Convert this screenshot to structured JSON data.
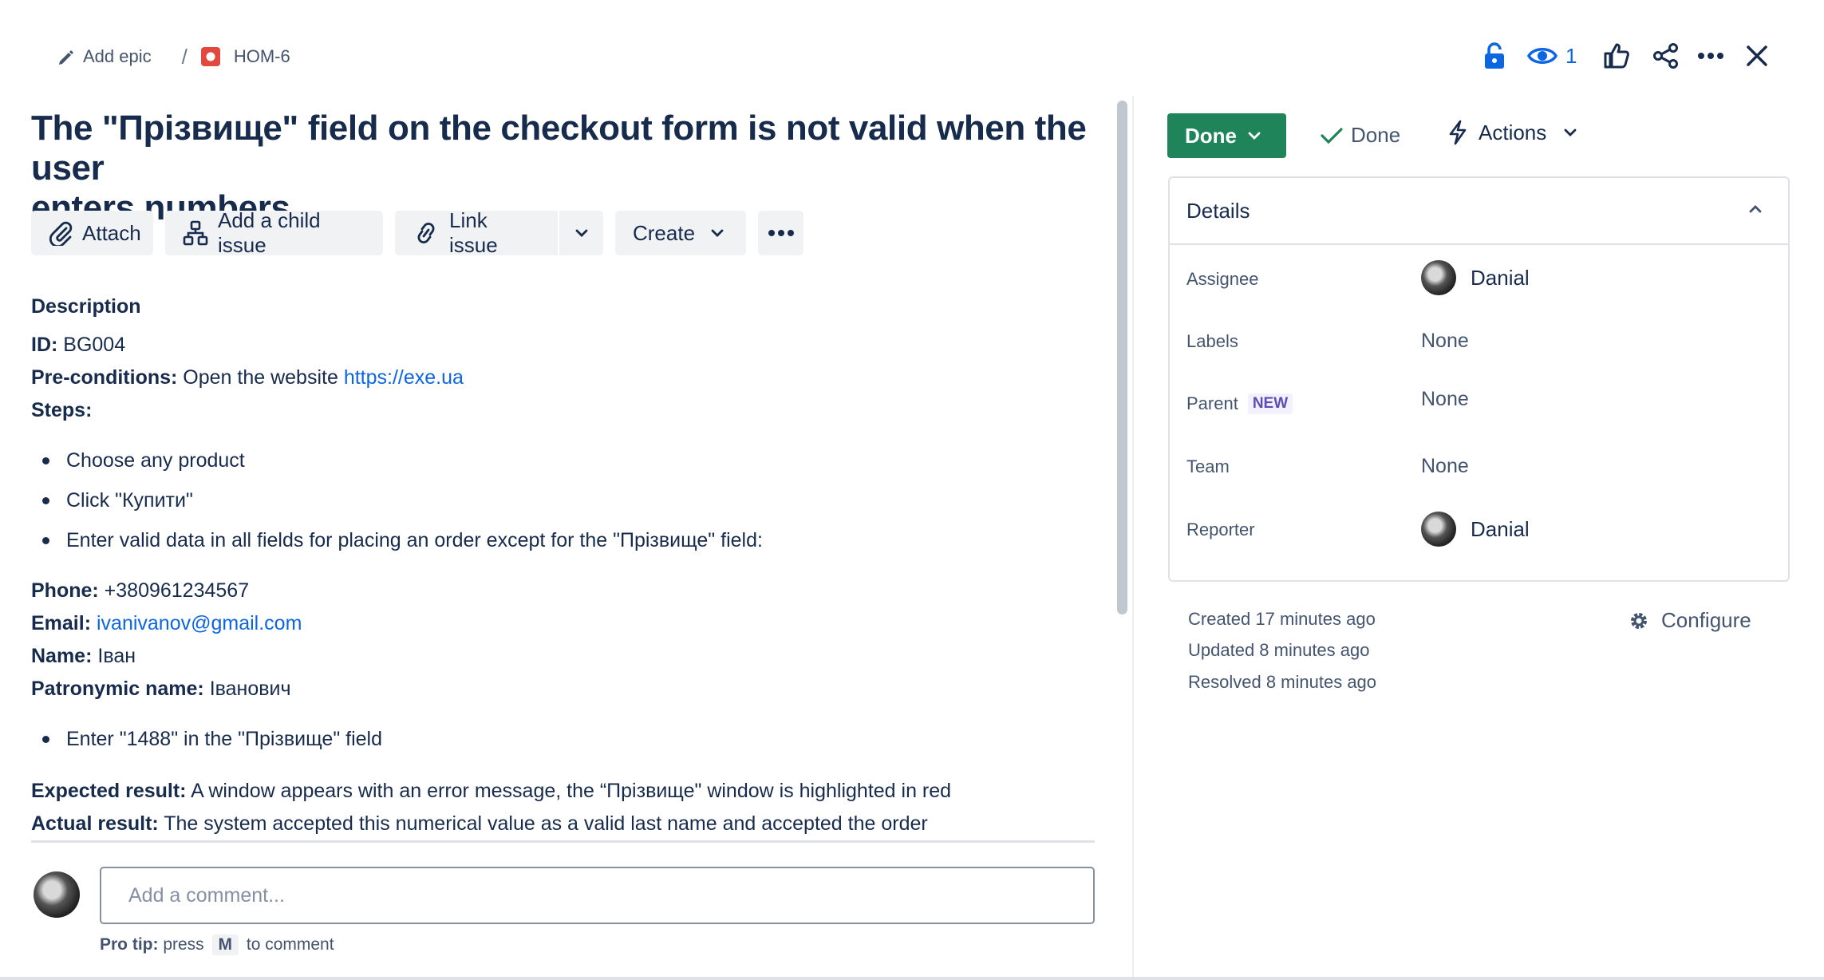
{
  "breadcrumb": {
    "add_epic": "Add epic",
    "separator": "/",
    "issue_key": "HOM-6"
  },
  "header": {
    "watch_count": "1"
  },
  "issue": {
    "title_line1": "The \"Прізвище\" field on the checkout form is not valid when the user",
    "title_line2": "enters numbers."
  },
  "toolbar": {
    "attach": "Attach",
    "add_child": "Add a child issue",
    "link_issue": "Link issue",
    "create": "Create"
  },
  "description": {
    "heading": "Description",
    "id_label": "ID:",
    "id_value": " BG004",
    "pre_label": "Pre-conditions:",
    "pre_text": " Open the website ",
    "pre_link": "https://exe.ua",
    "steps_label": "Steps:",
    "steps": [
      "Choose any product",
      "Click \"Купити\"",
      "Enter valid data in all fields for placing an order except for the \"Прізвище\" field:"
    ],
    "phone_label": "Phone:",
    "phone_value": " +380961234567",
    "email_label": "Email:",
    "email_value": "ivanivanov@gmail.com",
    "name_label": "Name:",
    "name_value": " Іван",
    "patronymic_label": "Patronymic name:",
    "patronymic_value": " Іванович",
    "step4": "Enter \"1488\" in the \"Прізвище\" field",
    "expected_label": "Expected result:",
    "expected_value": " A window appears with an error message, the “Прізвище\" window is highlighted in red",
    "actual_label": "Actual result:",
    "actual_value": " The system accepted this numerical value as a valid last name and accepted the order"
  },
  "comment": {
    "placeholder": "Add a comment...",
    "tip_label": "Pro tip:",
    "tip_press": " press ",
    "tip_key": "M",
    "tip_end": " to comment"
  },
  "status": {
    "button": "Done",
    "resolution": "Done",
    "actions": "Actions"
  },
  "details": {
    "heading": "Details",
    "assignee_label": "Assignee",
    "assignee": "Danial",
    "labels_label": "Labels",
    "labels_value": "None",
    "parent_label": "Parent",
    "parent_badge": "NEW",
    "parent_value": "None",
    "team_label": "Team",
    "team_value": "None",
    "reporter_label": "Reporter",
    "reporter": "Danial"
  },
  "meta": {
    "created": "Created 17 minutes ago",
    "updated": "Updated 8 minutes ago",
    "resolved": "Resolved 8 minutes ago",
    "configure": "Configure"
  },
  "colors": {
    "status_green": "#1f845a",
    "link_blue": "#0c66e4",
    "icon_blue": "#0c66e4",
    "issue_red": "#e2483d"
  }
}
